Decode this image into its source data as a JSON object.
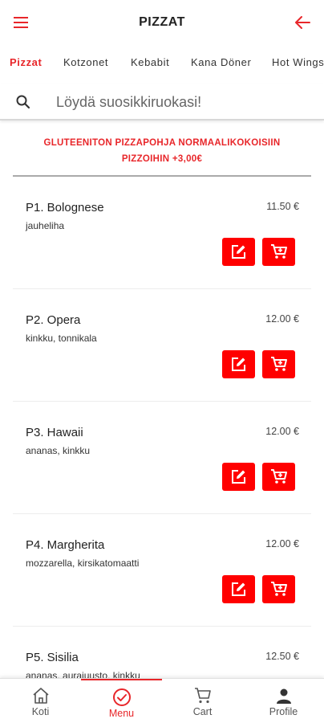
{
  "header": {
    "title": "PIZZAT"
  },
  "tabs": [
    {
      "label": "Pizzat",
      "active": true
    },
    {
      "label": "Kotzonet",
      "active": false
    },
    {
      "label": "Kebabit",
      "active": false
    },
    {
      "label": "Kana Döner",
      "active": false
    },
    {
      "label": "Hot Wings",
      "active": false
    }
  ],
  "search": {
    "placeholder": "Löydä suosikkiruokasi!",
    "value": ""
  },
  "notice": {
    "text": "GLUTEENITON PIZZAPOHJA NORMAALIKOKOISIIN PIZZOIHIN +3,00€"
  },
  "items": [
    {
      "name": "P1. Bolognese",
      "desc": "jauheliha",
      "price": "11.50 €"
    },
    {
      "name": "P2. Opera",
      "desc": "kinkku, tonnikala",
      "price": "12.00 €"
    },
    {
      "name": "P3. Hawaii",
      "desc": "ananas, kinkku",
      "price": "12.00 €"
    },
    {
      "name": "P4. Margherita",
      "desc": "mozzarella, kirsikatomaatti",
      "price": "12.00 €"
    },
    {
      "name": "P5. Sisilia",
      "desc": "ananas, aurajuusto, kinkku",
      "price": "12.50 €"
    }
  ],
  "nav": [
    {
      "label": "Koti",
      "icon": "home-icon",
      "active": false
    },
    {
      "label": "Menu",
      "icon": "check-circle-icon",
      "active": true
    },
    {
      "label": "Cart",
      "icon": "cart-icon",
      "active": false
    },
    {
      "label": "Profile",
      "icon": "user-icon",
      "active": false
    }
  ],
  "colors": {
    "accent": "#e8262a",
    "button": "#ff0000"
  }
}
